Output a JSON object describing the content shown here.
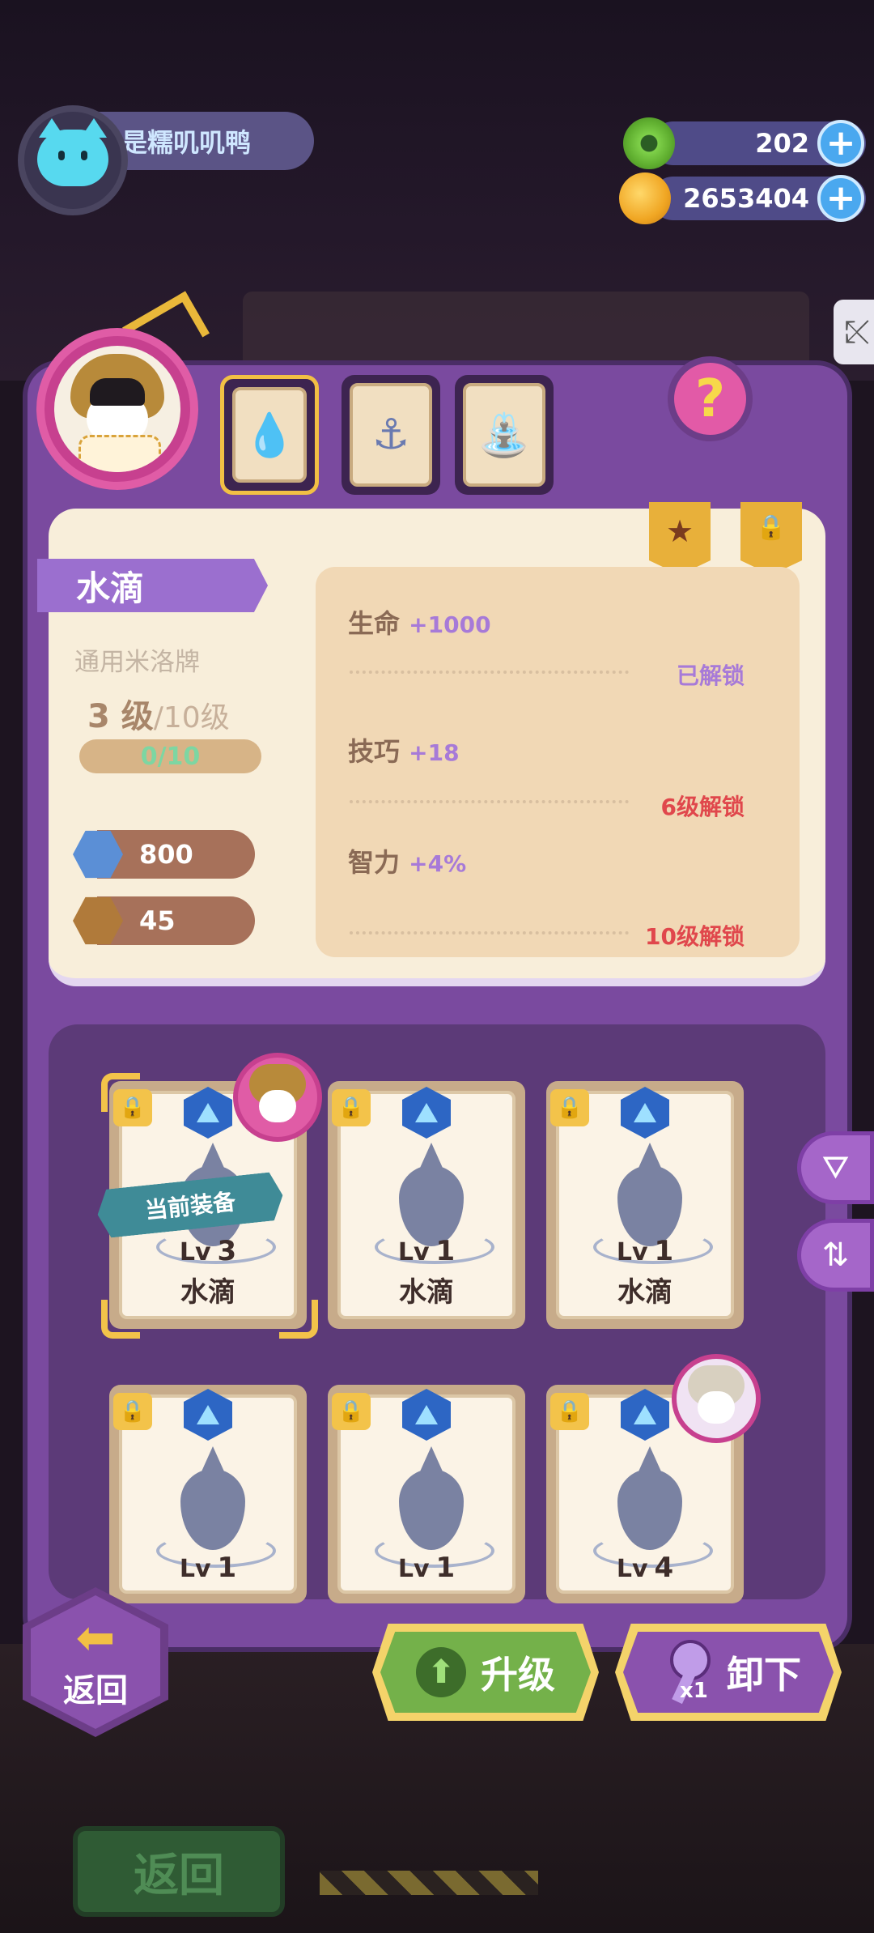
{
  "player": {
    "name": "是糯叽叽鸭"
  },
  "resources": [
    {
      "icon": "green-donut-icon",
      "value": "202"
    },
    {
      "icon": "gold-planet-icon",
      "value": "2653404"
    }
  ],
  "slots": [
    {
      "icon": "water-drop-icon",
      "glyph": "💧",
      "selected": true
    },
    {
      "icon": "anchor-icon",
      "glyph": "⚓",
      "selected": false
    },
    {
      "icon": "fountain-icon",
      "glyph": "⛲",
      "selected": false
    }
  ],
  "help_label": "?",
  "equipment": {
    "name": "水滴",
    "type": "通用米洛牌",
    "level": "3 级",
    "level_max": "/10级",
    "exp": "0/10",
    "stats": [
      {
        "icon": "heart-hex-icon",
        "value": "800",
        "color": "#5b8fd6"
      },
      {
        "icon": "brain-hex-icon",
        "value": "45",
        "color": "#b07a3a"
      }
    ]
  },
  "attributes": [
    {
      "name": "生命",
      "value": "+1000",
      "status": "已解锁",
      "status_color": "#a77ad8"
    },
    {
      "name": "技巧",
      "value": "+18",
      "status": "6级解锁",
      "status_color": "#e0474c"
    },
    {
      "name": "智力",
      "value": "+4%",
      "status": "10级解锁",
      "status_color": "#e0474c"
    }
  ],
  "cards": [
    {
      "lv_label": "Lv",
      "level": "3",
      "name": "水滴",
      "equipped": true
    },
    {
      "lv_label": "Lv",
      "level": "1",
      "name": "水滴",
      "equipped": false
    },
    {
      "lv_label": "Lv",
      "level": "1",
      "name": "水滴",
      "equipped": false
    },
    {
      "lv_label": "Lv",
      "level": "1",
      "name": "",
      "equipped": false
    },
    {
      "lv_label": "Lv",
      "level": "1",
      "name": "",
      "equipped": false
    },
    {
      "lv_label": "Lv",
      "level": "4",
      "name": "",
      "equipped": false
    }
  ],
  "equipped_tag": "当前装备",
  "buttons": {
    "back": "返回",
    "upgrade": "升级",
    "unequip": "卸下",
    "key_count": "x1",
    "bg_back": "返回"
  }
}
